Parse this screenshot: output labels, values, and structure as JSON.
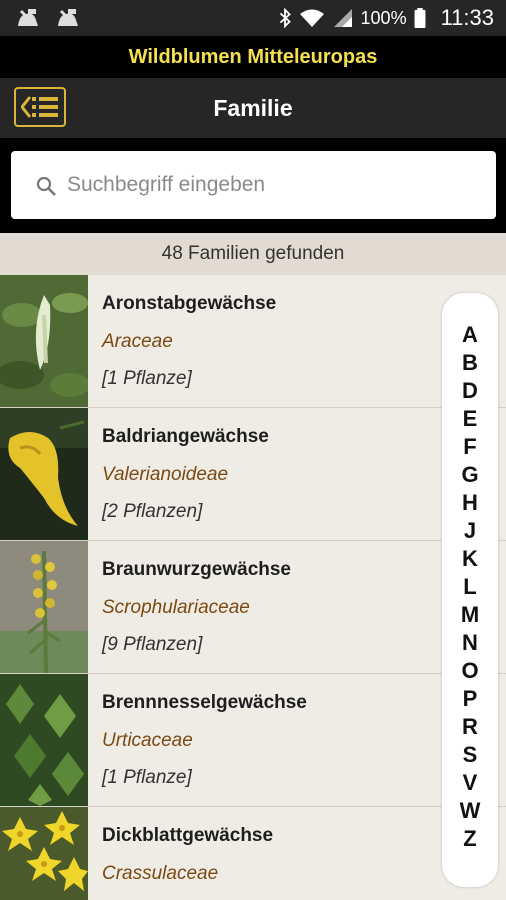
{
  "status_bar": {
    "battery": "100%",
    "time": "11:33",
    "icons": [
      "notification-icon",
      "notification-icon",
      "bluetooth-icon",
      "wifi-icon",
      "signal-icon",
      "battery-icon"
    ]
  },
  "app_title": "Wildblumen Mitteleuropas",
  "toolbar": {
    "title": "Familie",
    "back_icon": "list-back-icon"
  },
  "search": {
    "placeholder": "Suchbegriff eingeben",
    "value": "",
    "icon": "search-icon"
  },
  "result_count": "48 Familien gefunden",
  "families": [
    {
      "name": "Aronstabgewächse",
      "latin": "Araceae",
      "count": "[1 Pflanze]",
      "image": "arum-photo"
    },
    {
      "name": "Baldriangewächse",
      "latin": "Valerianoideae",
      "count": "[2 Pflanzen]",
      "image": "yellow-flower-photo"
    },
    {
      "name": "Braunwurzgewächse",
      "latin": "Scrophulariaceae",
      "count": "[9 Pflanzen]",
      "image": "yellow-spike-photo"
    },
    {
      "name": "Brennnesselgewächse",
      "latin": "Urticaceae",
      "count": "[1 Pflanze]",
      "image": "nettle-photo"
    },
    {
      "name": "Dickblattgewächse",
      "latin": "Crassulaceae",
      "count": "",
      "image": "stonecrop-photo"
    }
  ],
  "alphabet_index": [
    "A",
    "B",
    "D",
    "E",
    "F",
    "G",
    "H",
    "J",
    "K",
    "L",
    "M",
    "N",
    "O",
    "P",
    "R",
    "S",
    "V",
    "W",
    "Z"
  ],
  "colors": {
    "title_yellow": "#f4e04d",
    "latin_brown": "#7a4a12",
    "list_bg": "#efece6",
    "result_bar_bg": "#e2dbd1",
    "back_border": "#d9b63a"
  }
}
